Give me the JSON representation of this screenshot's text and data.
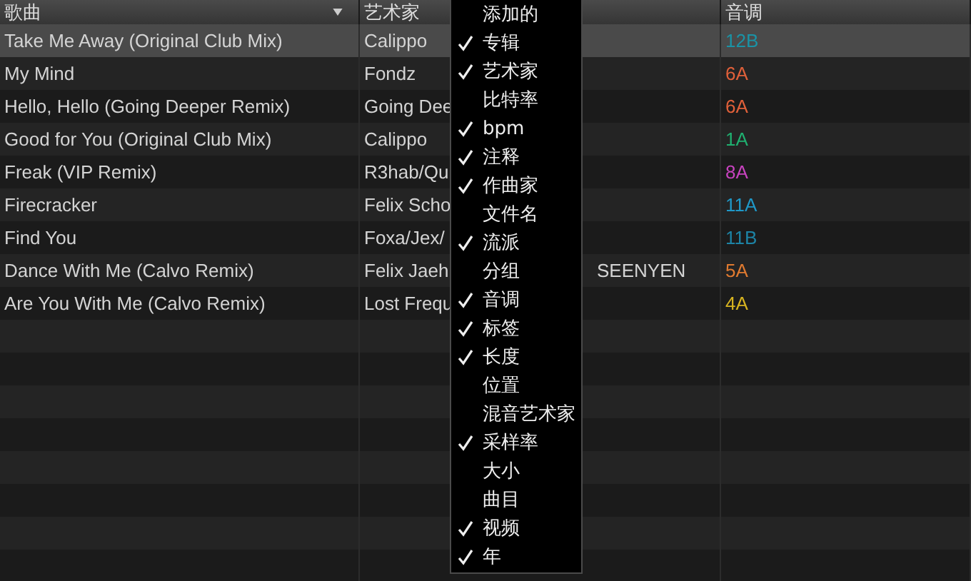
{
  "table": {
    "columns": [
      {
        "label": "歌曲",
        "sorted": true
      },
      {
        "label": "艺术家",
        "sorted": false
      },
      {
        "label": "音调",
        "sorted": false
      }
    ],
    "rows": [
      {
        "title": "Take Me Away (Original Club Mix)",
        "artist": "Calippo",
        "key": "12B",
        "color": "#1a93a6",
        "selected": true
      },
      {
        "title": "My Mind",
        "artist": "Fondz",
        "key": "6A",
        "color": "#e0603a",
        "selected": false
      },
      {
        "title": "Hello, Hello (Going Deeper Remix)",
        "artist": "Going Dee",
        "key": "6A",
        "color": "#e0603a",
        "selected": false
      },
      {
        "title": "Good for You (Original Club Mix)",
        "artist": "Calippo",
        "key": "1A",
        "color": "#1fb070",
        "selected": false
      },
      {
        "title": "Freak (VIP Remix)",
        "artist": "R3hab/Qu",
        "key": "8A",
        "color": "#c843c0",
        "selected": false
      },
      {
        "title": "Firecracker",
        "artist": "Felix Scho",
        "key": "11A",
        "color": "#1f98c8",
        "selected": false
      },
      {
        "title": "Find You",
        "artist": "Foxa/Jex/",
        "key": "11B",
        "color": "#1d84a6",
        "selected": false
      },
      {
        "title": "Dance With Me (Calvo Remix)",
        "artist": "Felix Jaeh",
        "artist_tail": "SEENYEN",
        "key": "5A",
        "color": "#e07a30",
        "selected": false
      },
      {
        "title": "Are You With Me (Calvo Remix)",
        "artist": "Lost Frequ",
        "key": "4A",
        "color": "#d8b420",
        "selected": false
      }
    ]
  },
  "column_menu": {
    "items": [
      {
        "label": "添加的",
        "checked": false
      },
      {
        "label": "专辑",
        "checked": true
      },
      {
        "label": "艺术家",
        "checked": true
      },
      {
        "label": "比特率",
        "checked": false
      },
      {
        "label": "bpm",
        "checked": true
      },
      {
        "label": "注释",
        "checked": true
      },
      {
        "label": "作曲家",
        "checked": true
      },
      {
        "label": "文件名",
        "checked": false
      },
      {
        "label": "流派",
        "checked": true
      },
      {
        "label": "分组",
        "checked": false
      },
      {
        "label": "音调",
        "checked": true
      },
      {
        "label": "标签",
        "checked": true
      },
      {
        "label": "长度",
        "checked": true
      },
      {
        "label": "位置",
        "checked": false
      },
      {
        "label": "混音艺术家",
        "checked": false
      },
      {
        "label": "采样率",
        "checked": true
      },
      {
        "label": "大小",
        "checked": false
      },
      {
        "label": "曲目",
        "checked": false
      },
      {
        "label": "视频",
        "checked": true
      },
      {
        "label": "年",
        "checked": true
      }
    ]
  }
}
